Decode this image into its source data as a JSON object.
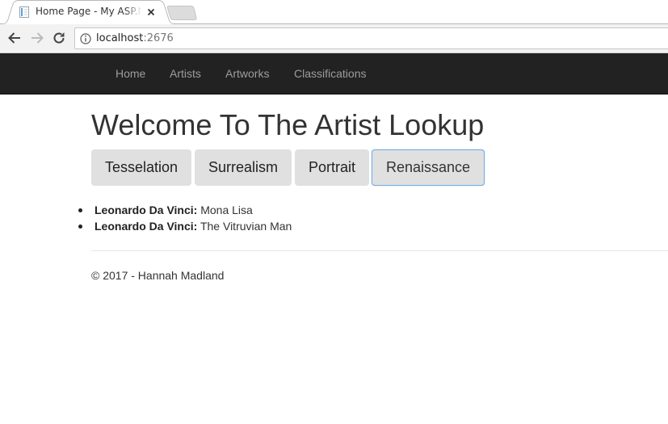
{
  "browser": {
    "tab": {
      "title": "Home Page - My ASP.NE"
    },
    "address": {
      "host": "localhost",
      "port": ":2676"
    }
  },
  "nav": {
    "items": [
      {
        "label": "Home"
      },
      {
        "label": "Artists"
      },
      {
        "label": "Artworks"
      },
      {
        "label": "Classifications"
      }
    ]
  },
  "main": {
    "heading": "Welcome To The Artist Lookup",
    "categories": [
      {
        "label": "Tesselation",
        "selected": false
      },
      {
        "label": "Surrealism",
        "selected": false
      },
      {
        "label": "Portrait",
        "selected": false
      },
      {
        "label": "Renaissance",
        "selected": true
      }
    ],
    "artworks": [
      {
        "artist": "Leonardo Da Vinci:",
        "title": "Mona Lisa"
      },
      {
        "artist": "Leonardo Da Vinci:",
        "title": "The Vitruvian Man"
      }
    ]
  },
  "footer": {
    "text": "© 2017 - Hannah Madland"
  },
  "colors": {
    "navbar_bg": "#222222",
    "nav_link": "#9d9d9d",
    "button_bg": "#e0e0e0",
    "focus_border": "#73aee8"
  }
}
